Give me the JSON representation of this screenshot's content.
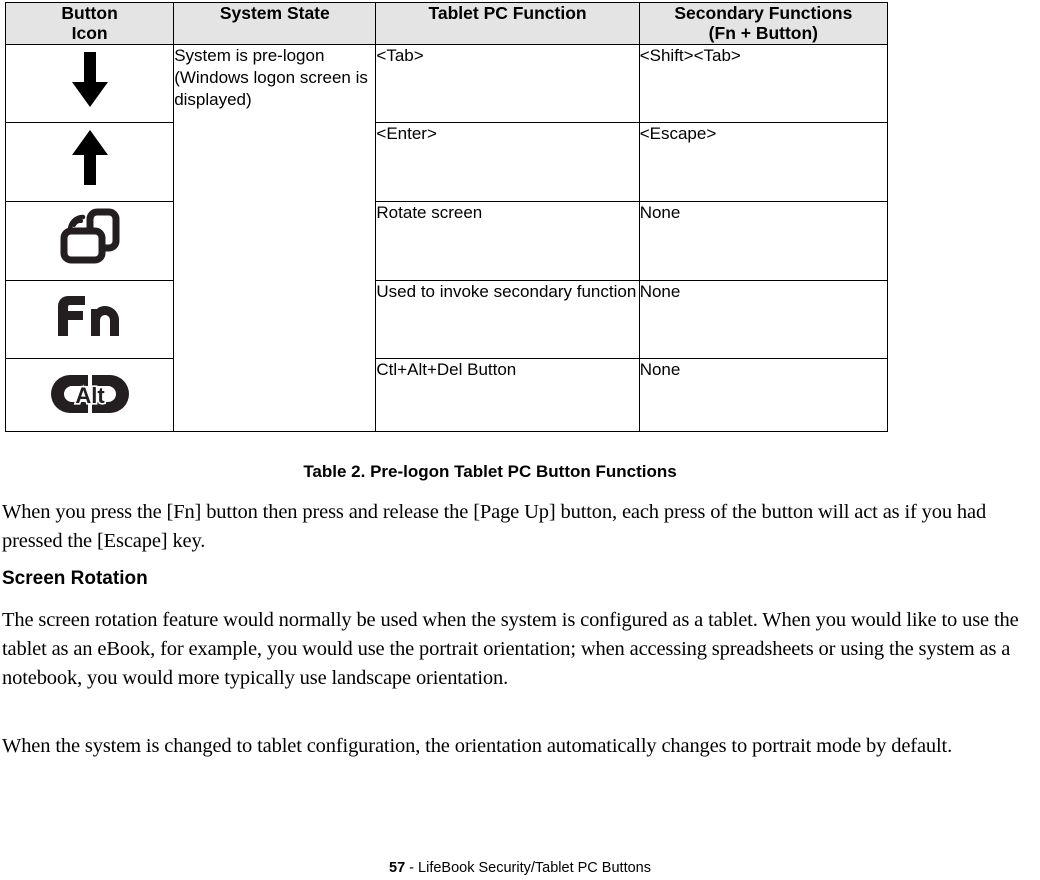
{
  "table": {
    "headers": [
      {
        "line1": "Button",
        "line2": "Icon"
      },
      {
        "line1": "System State",
        "line2": ""
      },
      {
        "line1": "Tablet PC Function",
        "line2": ""
      },
      {
        "line1": "Secondary Functions",
        "line2": "(Fn + Button)"
      }
    ],
    "system_state": "System is pre-logon (Windows logon screen is displayed)",
    "rows": [
      {
        "icon": "arrow-down-icon",
        "function": "<Tab>",
        "secondary": "<Shift><Tab>"
      },
      {
        "icon": "arrow-up-icon",
        "function": "<Enter>",
        "secondary": "<Escape>"
      },
      {
        "icon": "rotate-screen-icon",
        "function": "Rotate screen",
        "secondary": "None"
      },
      {
        "icon": "fn-key-icon",
        "function": "Used to invoke secondary function",
        "secondary": "None"
      },
      {
        "icon": "alt-key-icon",
        "function": "Ctl+Alt+Del Button",
        "secondary": "None"
      }
    ]
  },
  "caption": "Table 2.  Pre-logon Tablet PC Button Functions",
  "paragraphs": {
    "p1": "When you press the [Fn] button then press and release the [Page Up] button, each press of the button will act as if you had pressed the [Escape] key.",
    "p2": "The screen rotation feature would normally be used when the system is configured as a tablet. When you would like to use the tablet as an eBook, for example, you would use the portrait orientation; when accessing spreadsheets or using the system as a notebook, you would more typically use landscape orientation.",
    "p3": "When the system is changed to tablet configuration, the orientation automatically changes to portrait mode by default."
  },
  "section_heading": "Screen Rotation",
  "footer": {
    "page_number": "57",
    "separator": " - ",
    "title": "LifeBook Security/Tablet PC Buttons"
  },
  "colors": {
    "header_background": "#e4e4e4",
    "border": "#000000",
    "icon": "#231f20",
    "text": "#000000",
    "page_background": "#ffffff"
  }
}
